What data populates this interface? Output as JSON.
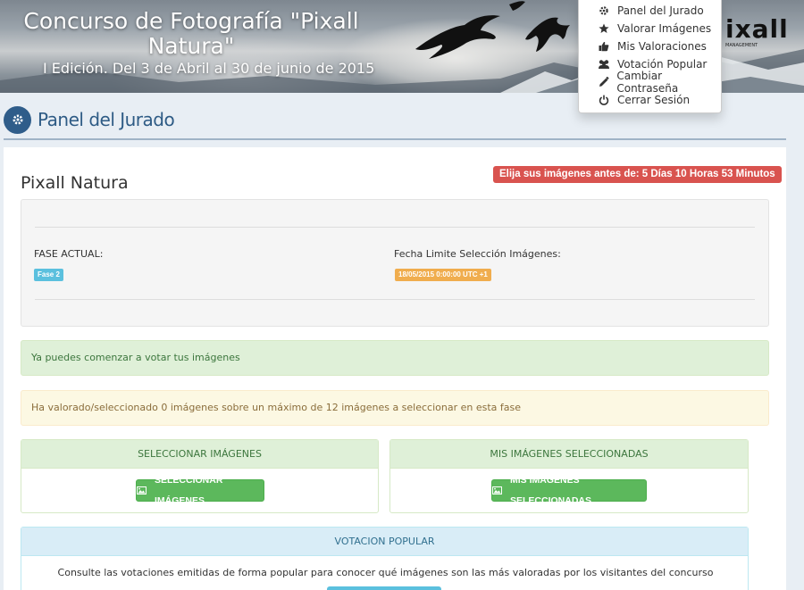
{
  "banner": {
    "title": "Concurso de Fotografía \"Pixall Natura\"",
    "subtitle": "I Edición. Del 3 de Abril al 30 de junio de 2015",
    "logo_text": "ixall",
    "logo_small": "MANAGEMENT"
  },
  "menu": {
    "items": [
      {
        "label": "Panel del Jurado",
        "icon": "gear-icon"
      },
      {
        "label": "Valorar Imágenes",
        "icon": "star-icon"
      },
      {
        "label": "Mis Valoraciones",
        "icon": "thumbs-up-icon"
      },
      {
        "label": "Votación Popular",
        "icon": "users-icon"
      },
      {
        "label": "Cambiar Contraseña",
        "icon": "pencil-icon"
      },
      {
        "label": "Cerrar Sesión",
        "icon": "power-icon"
      }
    ]
  },
  "page": {
    "title": "Panel del Jurado"
  },
  "contest": {
    "name": "Pixall Natura",
    "deadline": "Elija sus imágenes antes de: 5 Días 10 Horas 53 Minutos",
    "phase_label": "FASE ACTUAL:",
    "phase_value": "Fase 2",
    "date_label": "Fecha Limite Selección Imágenes:",
    "date_value": "18/05/2015 0:00:00 UTC +1"
  },
  "alerts": {
    "success": "Ya puedes comenzar a votar tus imágenes",
    "warning": "Ha valorado/seleccionado 0 imágenes sobre un máximo de 12 imágenes a seleccionar en esta fase"
  },
  "panels": {
    "select": {
      "heading": "SELECCIONAR IMÁGENES",
      "button": "SELECCIONAR IMÁGENES"
    },
    "mine": {
      "heading": "MIS IMÁGENES SELECCIONADAS",
      "button": "MIS IMÁGENES SELECCIONADAS"
    },
    "popular": {
      "heading": "VOTACION POPULAR",
      "text": "Consulte las votaciones emitidas de forma popular para conocer qué imágenes son las más valoradas por los visitantes del concurso"
    }
  },
  "colors": {
    "primary": "#2f5d8a",
    "danger": "#d9534f",
    "success": "#5cb85c",
    "info": "#5bc0de",
    "warning": "#f0ad4e"
  }
}
